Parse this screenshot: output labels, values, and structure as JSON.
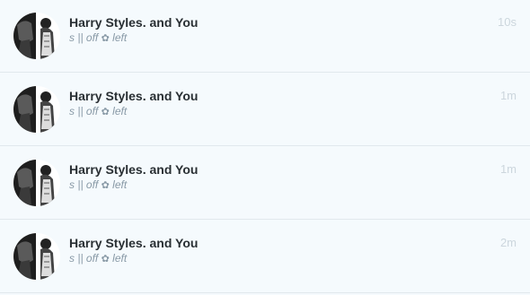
{
  "feed": {
    "items": [
      {
        "name": "Harry Styles. and You",
        "status_before": "s || off",
        "status_flower": "✿",
        "status_after": "left",
        "time": "10s",
        "avatar_icon": "profile-photo"
      },
      {
        "name": "Harry Styles. and You",
        "status_before": "s || off",
        "status_flower": "✿",
        "status_after": "left",
        "time": "1m",
        "avatar_icon": "profile-photo"
      },
      {
        "name": "Harry Styles. and You",
        "status_before": "s || off",
        "status_flower": "✿",
        "status_after": "left",
        "time": "1m",
        "avatar_icon": "profile-photo"
      },
      {
        "name": "Harry Styles. and You",
        "status_before": "s || off",
        "status_flower": "✿",
        "status_after": "left",
        "time": "2m",
        "avatar_icon": "profile-photo"
      }
    ]
  },
  "colors": {
    "background": "#f5fafd",
    "divider": "#e1e8ed",
    "name": "#292f33",
    "status": "#8899a6",
    "time": "#ccd6dd"
  }
}
